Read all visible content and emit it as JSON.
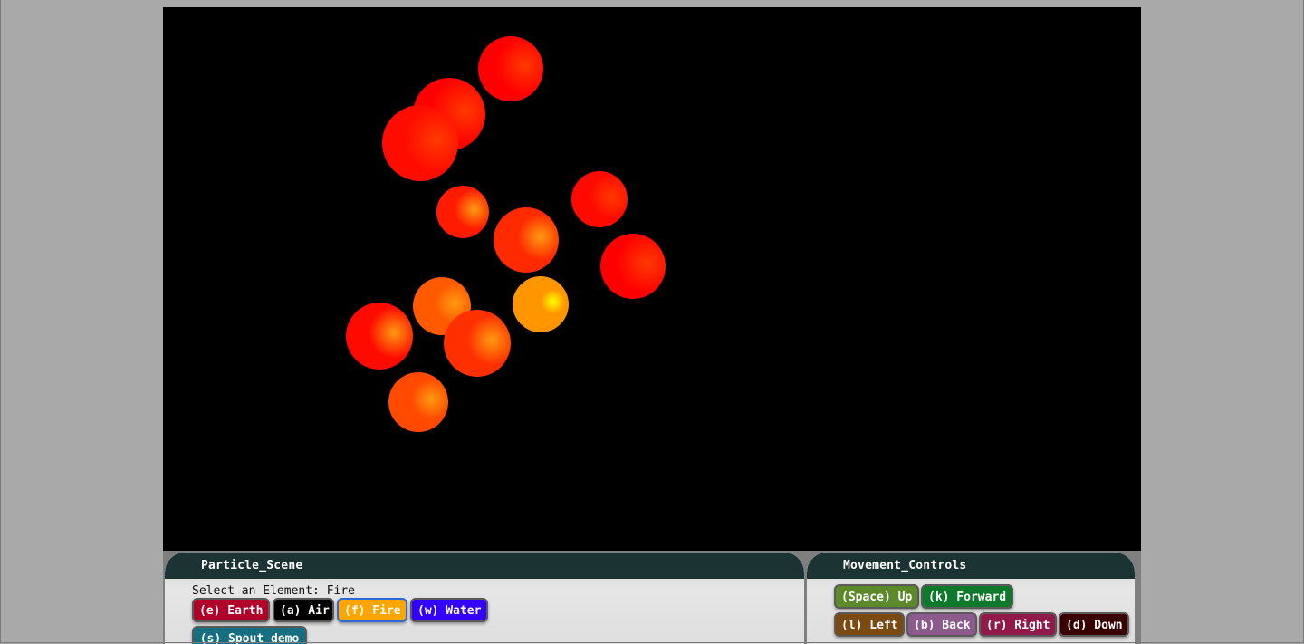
{
  "scene": {
    "background": "#000000",
    "particles": [
      {
        "color": "#ff0000",
        "hot": 0.15
      },
      {
        "color": "#ff0000",
        "hot": 0.05
      },
      {
        "color": "#ff0c00",
        "hot": 0.2
      },
      {
        "color": "#ff1a00",
        "hot": 0.35
      },
      {
        "color": "#ff0a00",
        "hot": 0.3
      },
      {
        "color": "#ff2a00",
        "hot": 0.45
      },
      {
        "color": "#ff0000",
        "hot": 0.05
      },
      {
        "color": "#ff5a00",
        "hot": 0.5
      },
      {
        "color": "#ff9600",
        "hot": 0.9
      },
      {
        "color": "#ff0a00",
        "hot": 0.35
      },
      {
        "color": "#ff3000",
        "hot": 0.4
      },
      {
        "color": "#ff4a00",
        "hot": 0.5
      }
    ]
  },
  "particle_scene": {
    "title": "Particle_Scene",
    "select_label": "Select an Element: Fire",
    "buttons": {
      "earth": {
        "label": "(e) Earth",
        "color": "#b0002a"
      },
      "air": {
        "label": "(a) Air",
        "color": "#000000"
      },
      "fire": {
        "label": "(f) Fire",
        "color": "#ffa500"
      },
      "water": {
        "label": "(w) Water",
        "color": "#3300ff"
      },
      "spout": {
        "label": "(s) Spout demo",
        "color": "#156f80"
      }
    }
  },
  "movement_controls": {
    "title": "Movement_Controls",
    "buttons": {
      "up": {
        "label": "(Space) Up",
        "color": "#5c8a2a"
      },
      "forward": {
        "label": "(k) Forward",
        "color": "#0c7a2a"
      },
      "left": {
        "label": "(l) Left",
        "color": "#7a4a10"
      },
      "back": {
        "label": "(b) Back",
        "color": "#8c5a8c"
      },
      "right": {
        "label": "(r) Right",
        "color": "#901a4a"
      },
      "down": {
        "label": "(d) Down",
        "color": "#3a0000"
      }
    }
  }
}
